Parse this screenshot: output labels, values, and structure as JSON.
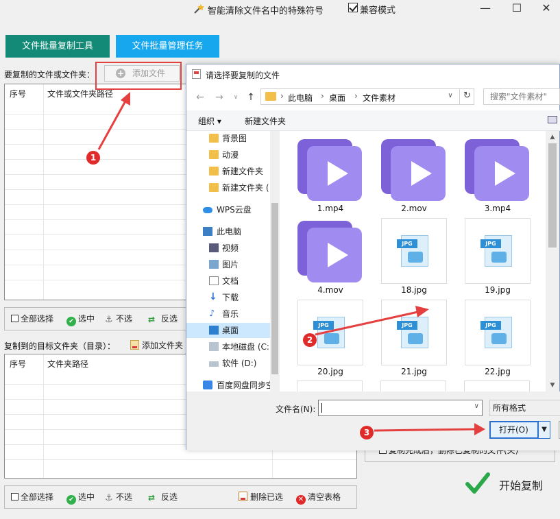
{
  "app": {
    "title": "智能清除文件名中的特殊符号",
    "compat_mode_label": "兼容模式",
    "compat_mode_checked": true
  },
  "window_controls": {
    "minimize": "—",
    "maximize": "☐",
    "close": "✕"
  },
  "tabs": [
    {
      "label": "文件批量复制工具",
      "active": true,
      "color": "#138a77"
    },
    {
      "label": "文件批量管理任务",
      "active": false,
      "color": "#16a7ef"
    }
  ],
  "source_section": {
    "label": "要复制的文件或文件夹：",
    "add_file_button": "添加文件",
    "columns": [
      "序号",
      "文件或文件夹路径"
    ]
  },
  "source_toolbar": {
    "select_all": "全部选择",
    "select": "选中",
    "unselect": "不选",
    "invert": "反选"
  },
  "target_section": {
    "label": "复制到的目标文件夹（目录）：",
    "add_folder_button": "添加文件夹",
    "columns": [
      "序号",
      "文件夹路径"
    ]
  },
  "target_toolbar": {
    "select_all": "全部选择",
    "select": "选中",
    "unselect": "不选",
    "invert": "反选",
    "delete_selected": "删除已选",
    "clear_table": "清空表格"
  },
  "options": {
    "delete_after_copy": "复制完成后，删除已复制的文件(夹)"
  },
  "start_button": "开始复制",
  "dialog": {
    "title": "请选择要复制的文件",
    "breadcrumb": [
      "此电脑",
      "桌面",
      "文件素材"
    ],
    "search_placeholder": "搜索\"文件素材\"",
    "organize": "组织 ▾",
    "new_folder": "新建文件夹",
    "nav_items": [
      {
        "label": "背景图",
        "icon": "folder-icon"
      },
      {
        "label": "动漫",
        "icon": "folder-icon"
      },
      {
        "label": "新建文件夹",
        "icon": "folder-icon"
      },
      {
        "label": "新建文件夹 (",
        "icon": "folder-icon"
      },
      {
        "label": "WPS云盘",
        "icon": "cloud-icon"
      },
      {
        "label": "此电脑",
        "icon": "computer-icon"
      },
      {
        "label": "视频",
        "icon": "video-icon"
      },
      {
        "label": "图片",
        "icon": "picture-icon"
      },
      {
        "label": "文档",
        "icon": "document-icon"
      },
      {
        "label": "下载",
        "icon": "download-icon"
      },
      {
        "label": "音乐",
        "icon": "music-icon"
      },
      {
        "label": "桌面",
        "icon": "desktop-icon",
        "selected": true
      },
      {
        "label": "本地磁盘 (C:",
        "icon": "drive-icon"
      },
      {
        "label": "软件 (D:)",
        "icon": "drive-icon"
      },
      {
        "label": "百度网盘同步空",
        "icon": "baidu-icon"
      }
    ],
    "files": [
      {
        "name": "1.mp4",
        "type": "video"
      },
      {
        "name": "2.mov",
        "type": "video"
      },
      {
        "name": "3.mp4",
        "type": "video"
      },
      {
        "name": "4.mov",
        "type": "video"
      },
      {
        "name": "18.jpg",
        "type": "jpg"
      },
      {
        "name": "19.jpg",
        "type": "jpg"
      },
      {
        "name": "20.jpg",
        "type": "jpg"
      },
      {
        "name": "21.jpg",
        "type": "jpg"
      },
      {
        "name": "22.jpg",
        "type": "jpg"
      }
    ],
    "jpg_tag": "JPG",
    "filename_label": "文件名(N):",
    "filename_value": "",
    "format_select": "所有格式",
    "open_button": "打开(O)"
  },
  "annotations": {
    "step1": "1",
    "step2": "2",
    "step3": "3",
    "color": "#e02b2b"
  }
}
